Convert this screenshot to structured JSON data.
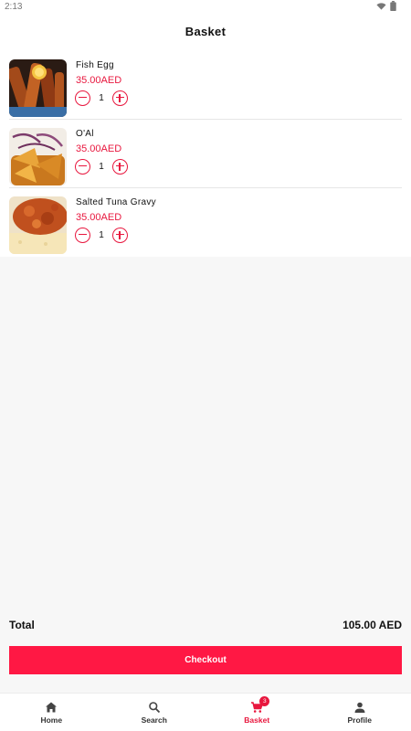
{
  "status_bar": {
    "time": "2:13"
  },
  "header": {
    "title": "Basket"
  },
  "basket": {
    "items": [
      {
        "name": "Fish Egg",
        "price": "35.00AED",
        "quantity": "1"
      },
      {
        "name": "O'Al",
        "price": "35.00AED",
        "quantity": "1"
      },
      {
        "name": "Salted Tuna Gravy",
        "price": "35.00AED",
        "quantity": "1"
      }
    ]
  },
  "summary": {
    "total_label": "Total",
    "total_value": "105.00 AED"
  },
  "checkout": {
    "label": "Checkout"
  },
  "nav": {
    "items": [
      {
        "label": "Home",
        "icon": "home-icon"
      },
      {
        "label": "Search",
        "icon": "search-icon"
      },
      {
        "label": "Basket",
        "icon": "cart-icon",
        "badge": "3",
        "active": true
      },
      {
        "label": "Profile",
        "icon": "profile-icon"
      }
    ]
  },
  "colors": {
    "accent": "#e8173e",
    "button": "#ff1844"
  }
}
